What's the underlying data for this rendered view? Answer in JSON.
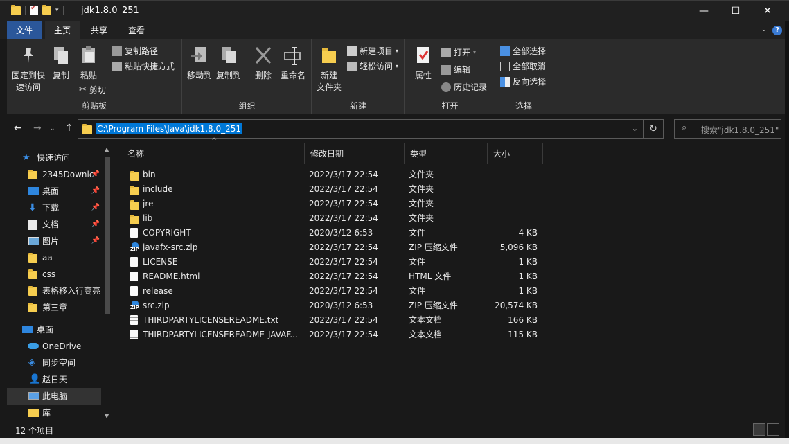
{
  "window": {
    "title": "jdk1.8.0_251",
    "minimize": "—",
    "maximize": "☐",
    "close": "✕"
  },
  "tabs": {
    "file": "文件",
    "home": "主页",
    "share": "共享",
    "view": "查看"
  },
  "ribbon": {
    "clipboard": {
      "label": "剪贴板",
      "pin": "固定到快\n速访问",
      "pin1": "固定到快",
      "pin2": "速访问",
      "copy": "复制",
      "paste": "粘贴",
      "copy_path": "复制路径",
      "paste_shortcut": "粘贴快捷方式",
      "cut": "剪切"
    },
    "organize": {
      "label": "组织",
      "move_to": "移动到",
      "copy_to": "复制到",
      "delete": "删除",
      "rename": "重命名"
    },
    "new": {
      "label": "新建",
      "new_folder1": "新建",
      "new_folder2": "文件夹",
      "new_item": "新建项目",
      "easy_access": "轻松访问"
    },
    "open": {
      "label": "打开",
      "properties": "属性",
      "open": "打开",
      "edit": "编辑",
      "history": "历史记录"
    },
    "select": {
      "label": "选择",
      "select_all": "全部选择",
      "select_none": "全部取消",
      "invert": "反向选择"
    }
  },
  "address": {
    "path": "C:\\Program Files\\Java\\jdk1.8.0_251",
    "search_placeholder": "搜索\"jdk1.8.0_251\""
  },
  "nav": {
    "quick_access": "快速访问",
    "items": [
      {
        "label": "2345Downlc",
        "pinned": true
      },
      {
        "label": "桌面",
        "pinned": true
      },
      {
        "label": "下载",
        "pinned": true
      },
      {
        "label": "文档",
        "pinned": true
      },
      {
        "label": "图片",
        "pinned": true
      },
      {
        "label": "aa",
        "pinned": false
      },
      {
        "label": "css",
        "pinned": false
      },
      {
        "label": "表格移入行高亮",
        "pinned": false
      },
      {
        "label": "第三章",
        "pinned": false
      }
    ],
    "desktop": "桌面",
    "onedrive": "OneDrive",
    "sync_space": "同步空间",
    "user": "赵日天",
    "this_pc": "此电脑",
    "library": "库"
  },
  "columns": {
    "name": "名称",
    "date": "修改日期",
    "type": "类型",
    "size": "大小"
  },
  "files": [
    {
      "name": "bin",
      "date": "2022/3/17 22:54",
      "type": "文件夹",
      "size": "",
      "icon": "folder"
    },
    {
      "name": "include",
      "date": "2022/3/17 22:54",
      "type": "文件夹",
      "size": "",
      "icon": "folder"
    },
    {
      "name": "jre",
      "date": "2022/3/17 22:54",
      "type": "文件夹",
      "size": "",
      "icon": "folder"
    },
    {
      "name": "lib",
      "date": "2022/3/17 22:54",
      "type": "文件夹",
      "size": "",
      "icon": "folder"
    },
    {
      "name": "COPYRIGHT",
      "date": "2020/3/12 6:53",
      "type": "文件",
      "size": "4 KB",
      "icon": "file"
    },
    {
      "name": "javafx-src.zip",
      "date": "2022/3/17 22:54",
      "type": "ZIP 压缩文件",
      "size": "5,096 KB",
      "icon": "zip"
    },
    {
      "name": "LICENSE",
      "date": "2022/3/17 22:54",
      "type": "文件",
      "size": "1 KB",
      "icon": "file"
    },
    {
      "name": "README.html",
      "date": "2022/3/17 22:54",
      "type": "HTML 文件",
      "size": "1 KB",
      "icon": "file"
    },
    {
      "name": "release",
      "date": "2022/3/17 22:54",
      "type": "文件",
      "size": "1 KB",
      "icon": "file"
    },
    {
      "name": "src.zip",
      "date": "2020/3/12 6:53",
      "type": "ZIP 压缩文件",
      "size": "20,574 KB",
      "icon": "zip"
    },
    {
      "name": "THIRDPARTYLICENSEREADME.txt",
      "date": "2022/3/17 22:54",
      "type": "文本文档",
      "size": "166 KB",
      "icon": "txt"
    },
    {
      "name": "THIRDPARTYLICENSEREADME-JAVAF...",
      "date": "2022/3/17 22:54",
      "type": "文本文档",
      "size": "115 KB",
      "icon": "txt"
    }
  ],
  "status": {
    "count": "12 个项目"
  }
}
